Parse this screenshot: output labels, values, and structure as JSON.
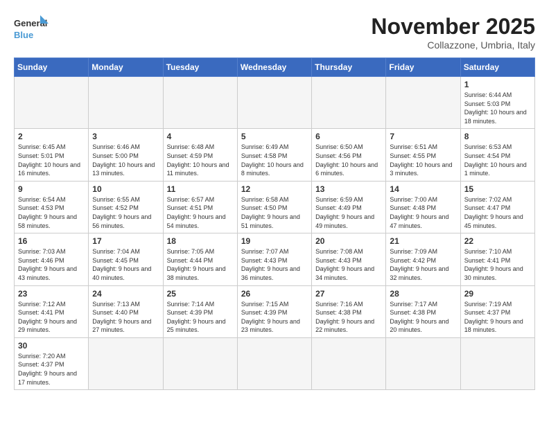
{
  "header": {
    "logo_general": "General",
    "logo_blue": "Blue",
    "month_title": "November 2025",
    "subtitle": "Collazzone, Umbria, Italy"
  },
  "weekdays": [
    "Sunday",
    "Monday",
    "Tuesday",
    "Wednesday",
    "Thursday",
    "Friday",
    "Saturday"
  ],
  "weeks": [
    [
      {
        "day": "",
        "info": ""
      },
      {
        "day": "",
        "info": ""
      },
      {
        "day": "",
        "info": ""
      },
      {
        "day": "",
        "info": ""
      },
      {
        "day": "",
        "info": ""
      },
      {
        "day": "",
        "info": ""
      },
      {
        "day": "1",
        "info": "Sunrise: 6:44 AM\nSunset: 5:03 PM\nDaylight: 10 hours and 18 minutes."
      }
    ],
    [
      {
        "day": "2",
        "info": "Sunrise: 6:45 AM\nSunset: 5:01 PM\nDaylight: 10 hours and 16 minutes."
      },
      {
        "day": "3",
        "info": "Sunrise: 6:46 AM\nSunset: 5:00 PM\nDaylight: 10 hours and 13 minutes."
      },
      {
        "day": "4",
        "info": "Sunrise: 6:48 AM\nSunset: 4:59 PM\nDaylight: 10 hours and 11 minutes."
      },
      {
        "day": "5",
        "info": "Sunrise: 6:49 AM\nSunset: 4:58 PM\nDaylight: 10 hours and 8 minutes."
      },
      {
        "day": "6",
        "info": "Sunrise: 6:50 AM\nSunset: 4:56 PM\nDaylight: 10 hours and 6 minutes."
      },
      {
        "day": "7",
        "info": "Sunrise: 6:51 AM\nSunset: 4:55 PM\nDaylight: 10 hours and 3 minutes."
      },
      {
        "day": "8",
        "info": "Sunrise: 6:53 AM\nSunset: 4:54 PM\nDaylight: 10 hours and 1 minute."
      }
    ],
    [
      {
        "day": "9",
        "info": "Sunrise: 6:54 AM\nSunset: 4:53 PM\nDaylight: 9 hours and 58 minutes."
      },
      {
        "day": "10",
        "info": "Sunrise: 6:55 AM\nSunset: 4:52 PM\nDaylight: 9 hours and 56 minutes."
      },
      {
        "day": "11",
        "info": "Sunrise: 6:57 AM\nSunset: 4:51 PM\nDaylight: 9 hours and 54 minutes."
      },
      {
        "day": "12",
        "info": "Sunrise: 6:58 AM\nSunset: 4:50 PM\nDaylight: 9 hours and 51 minutes."
      },
      {
        "day": "13",
        "info": "Sunrise: 6:59 AM\nSunset: 4:49 PM\nDaylight: 9 hours and 49 minutes."
      },
      {
        "day": "14",
        "info": "Sunrise: 7:00 AM\nSunset: 4:48 PM\nDaylight: 9 hours and 47 minutes."
      },
      {
        "day": "15",
        "info": "Sunrise: 7:02 AM\nSunset: 4:47 PM\nDaylight: 9 hours and 45 minutes."
      }
    ],
    [
      {
        "day": "16",
        "info": "Sunrise: 7:03 AM\nSunset: 4:46 PM\nDaylight: 9 hours and 43 minutes."
      },
      {
        "day": "17",
        "info": "Sunrise: 7:04 AM\nSunset: 4:45 PM\nDaylight: 9 hours and 40 minutes."
      },
      {
        "day": "18",
        "info": "Sunrise: 7:05 AM\nSunset: 4:44 PM\nDaylight: 9 hours and 38 minutes."
      },
      {
        "day": "19",
        "info": "Sunrise: 7:07 AM\nSunset: 4:43 PM\nDaylight: 9 hours and 36 minutes."
      },
      {
        "day": "20",
        "info": "Sunrise: 7:08 AM\nSunset: 4:43 PM\nDaylight: 9 hours and 34 minutes."
      },
      {
        "day": "21",
        "info": "Sunrise: 7:09 AM\nSunset: 4:42 PM\nDaylight: 9 hours and 32 minutes."
      },
      {
        "day": "22",
        "info": "Sunrise: 7:10 AM\nSunset: 4:41 PM\nDaylight: 9 hours and 30 minutes."
      }
    ],
    [
      {
        "day": "23",
        "info": "Sunrise: 7:12 AM\nSunset: 4:41 PM\nDaylight: 9 hours and 29 minutes."
      },
      {
        "day": "24",
        "info": "Sunrise: 7:13 AM\nSunset: 4:40 PM\nDaylight: 9 hours and 27 minutes."
      },
      {
        "day": "25",
        "info": "Sunrise: 7:14 AM\nSunset: 4:39 PM\nDaylight: 9 hours and 25 minutes."
      },
      {
        "day": "26",
        "info": "Sunrise: 7:15 AM\nSunset: 4:39 PM\nDaylight: 9 hours and 23 minutes."
      },
      {
        "day": "27",
        "info": "Sunrise: 7:16 AM\nSunset: 4:38 PM\nDaylight: 9 hours and 22 minutes."
      },
      {
        "day": "28",
        "info": "Sunrise: 7:17 AM\nSunset: 4:38 PM\nDaylight: 9 hours and 20 minutes."
      },
      {
        "day": "29",
        "info": "Sunrise: 7:19 AM\nSunset: 4:37 PM\nDaylight: 9 hours and 18 minutes."
      }
    ],
    [
      {
        "day": "30",
        "info": "Sunrise: 7:20 AM\nSunset: 4:37 PM\nDaylight: 9 hours and 17 minutes."
      },
      {
        "day": "",
        "info": ""
      },
      {
        "day": "",
        "info": ""
      },
      {
        "day": "",
        "info": ""
      },
      {
        "day": "",
        "info": ""
      },
      {
        "day": "",
        "info": ""
      },
      {
        "day": "",
        "info": ""
      }
    ]
  ]
}
